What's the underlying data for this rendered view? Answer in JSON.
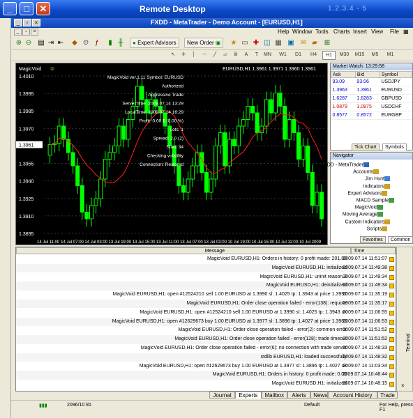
{
  "window": {
    "title": "Remote Desktop",
    "host": "1.2.3.4 - 5"
  },
  "mt": {
    "title": "FXDD - MetaTrader - Demo Account - [EURUSD,H1]"
  },
  "menu": [
    "File",
    "View",
    "Insert",
    "Charts",
    "Tools",
    "Window",
    "Help"
  ],
  "toolbar": {
    "new_order": "New Order",
    "expert_advisors": "Expert Advisors"
  },
  "timeframes": [
    "M1",
    "M5",
    "M15",
    "M30",
    "H1",
    "H4",
    "D1",
    "W1",
    "MN"
  ],
  "selected_timeframe": "H1",
  "chart": {
    "title": "EURUSD,H1  1.3961 1.3971 1.3960 1.3961",
    "ea_name": "MagicVoid",
    "info_lines": [
      "MagicVoid ver.1.11 Symbol: EURUSD",
      "Authorized",
      "Aggressive Trade",
      "ServerTime: 2009.07.14 13:29",
      "LocalTime: 2009.07.14 16:29",
      "Profit: 0.00 $ (0.00 %)",
      "Lots: 1",
      "Spread: 2.0 (2)",
      "Start: 34",
      "Checking volatility",
      "Connection: Restored"
    ],
    "price_labels": [
      "1.4010",
      "1.3995",
      "1.3985",
      "1.3970",
      "1.3961",
      "1.3955",
      "1.3940",
      "1.3925",
      "1.3910",
      "1.3895"
    ],
    "time_labels": [
      "10 Jul 2009",
      "10 Jul 11:00",
      "10 Jul 15:00",
      "10 Jul 19:00",
      "13 Jul 03:00",
      "13 Jul 07:00",
      "13 Jul 11:00",
      "13 Jul 15:00",
      "13 Jul 19:00",
      "14 Jul 03:00",
      "14 Jul 07:00",
      "14 Jul 11:00"
    ],
    "colors": {
      "bg": "#000000",
      "candle": "#00ff00",
      "ma": "#ff2020",
      "grid": "#333333"
    }
  },
  "market_watch": {
    "title": "Market Watch: 13:29:58",
    "columns": [
      "Symbol",
      "Bid",
      "Ask"
    ],
    "rows": [
      {
        "symbol": "USDJPY",
        "bid": "93.06",
        "ask": "93.09",
        "color": "#0000cc"
      },
      {
        "symbol": "EURUSD",
        "bid": "1.3961",
        "ask": "1.3963",
        "color": "#0000cc"
      },
      {
        "symbol": "GBPUSD",
        "bid": "1.6283",
        "ask": "1.6287",
        "color": "#0000cc"
      },
      {
        "symbol": "USDCHF",
        "bid": "1.0875",
        "ask": "1.0879",
        "color": "#cc0000"
      },
      {
        "symbol": "EURGBP",
        "bid": "0.8572",
        "ask": "0.8577",
        "color": "#0000cc"
      }
    ],
    "tabs": [
      "Symbols",
      "Tick Chart"
    ]
  },
  "navigator": {
    "title": "Navigator",
    "items": [
      "FXDD - MetaTrader",
      "Accounts",
      "Jim Hunt",
      "Indicators",
      "Expert Advisors",
      "MACD Sample",
      "MagicVoid",
      "Moving Average",
      "Custom Indicators",
      "Scripts"
    ],
    "tabs": [
      "Common",
      "Favorites"
    ]
  },
  "terminal": {
    "columns": [
      "Time",
      "Message"
    ],
    "rows": [
      {
        "time": "2009.07.14 11:51:07",
        "msg": "MagicVoid EURUSD,H1: Orders in history: 0 profit made: 201.80"
      },
      {
        "time": "2009.07.14 11:49:38",
        "msg": "MagicVoid EURUSD,H1: initialized"
      },
      {
        "time": "2009.07.14 11:49:34",
        "msg": "MagicVoid EURUSD,H1: uninit reason 3"
      },
      {
        "time": "2009.07.14 11:49:34",
        "msg": "MagicVoid EURUSD,H1: deinitialized"
      },
      {
        "time": "2009.07.14 11:35:19",
        "msg": "MagicVoid EURUSD,H1: open #12524210 sell 1.00 EURUSD at 1.3990 sl: 1.4025 tp: 1.3943 at price 1.3992"
      },
      {
        "time": "2009.07.14 11:35:17",
        "msg": "MagicVoid EURUSD,H1: Order close operation failed - error(138): requote"
      },
      {
        "time": "2009.07.14 11:06:55",
        "msg": "MagicVoid EURUSD,H1: open #12524210 sell 1.00 EURUSD at 1.3990 sl: 1.4025 tp: 1.3943 ok"
      },
      {
        "time": "2009.07.14 11:06:53",
        "msg": "MagicVoid EURUSD,H1: open #12629673 buy 1.00 EURUSD at 1.3977 sl: 1.3896 tp: 1.4027 at price 1.3983"
      },
      {
        "time": "2009.07.14 11:51:52",
        "msg": "MagicVoid EURUSD,H1: Order close operation failed - error(2): common error"
      },
      {
        "time": "2009.07.14 11:51:52",
        "msg": "MagicVoid EURUSD,H1: Order close operation failed - error(128): trade timeout"
      },
      {
        "time": "2009.07.14 11:48:33",
        "msg": "MagicVoid EURUSD,H1: Order close operation failed - error(6): no connection with trade server"
      },
      {
        "time": "2009.07.14 11:48:32",
        "msg": "stdlib EURUSD,H1: loaded successfully"
      },
      {
        "time": "2009.07.14 11:03:34",
        "msg": "MagicVoid EURUSD,H1: open #12629673 buy 1.00 EURUSD at 1.3977 sl: 1.3896 tp: 1.4027 ok"
      },
      {
        "time": "2009.07.14 10:48:44",
        "msg": "MagicVoid EURUSD,H1: Orders in history: 0 profit made: 0.00"
      },
      {
        "time": "2009.07.14 10:48:15",
        "msg": "MagicVoid EURUSD,H1: initialized"
      }
    ],
    "tabs": [
      "Trade",
      "Account History",
      "News",
      "Alerts",
      "Mailbox",
      "Experts",
      "Journal"
    ],
    "active_tab": "Experts",
    "side_label": "Terminal"
  },
  "status": {
    "help": "For Help, press F1",
    "profile": "Default",
    "traffic": "2096/10 kb"
  }
}
